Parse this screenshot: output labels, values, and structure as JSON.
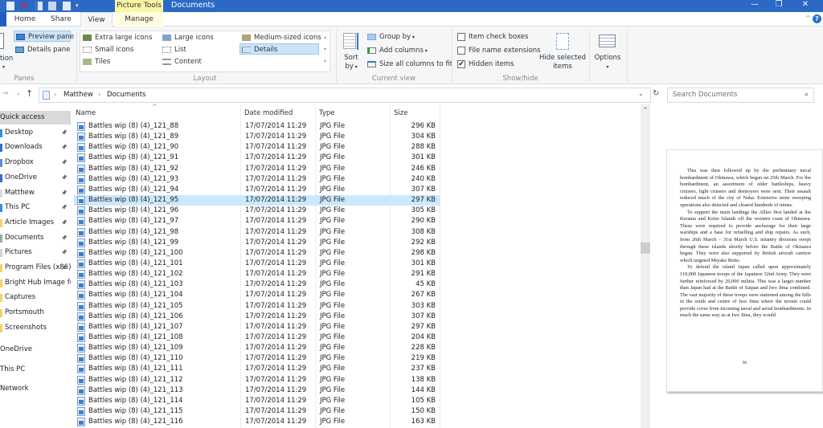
{
  "titlebar": {
    "contextual_tab": "Picture Tools",
    "window_title": "Documents",
    "quick_access_icons": [
      "new-file-icon",
      "delete-icon",
      "properties-icon",
      "recycle-icon",
      "rename-icon",
      "customize-dropdown-icon"
    ],
    "controls": {
      "minimize": "—",
      "restore": "❐",
      "close": "✕"
    }
  },
  "tabs": [
    {
      "label": "Home",
      "active": false
    },
    {
      "label": "Share",
      "active": false
    },
    {
      "label": "View",
      "active": true
    },
    {
      "label": "Manage",
      "active": false
    }
  ],
  "ribbon": {
    "panes": {
      "label": "Panes",
      "navigation_partial": "tion",
      "preview_pane": "Preview pane",
      "details_pane": "Details pane"
    },
    "layout": {
      "label": "Layout",
      "options": [
        "Extra large icons",
        "Large icons",
        "Medium-sized icons",
        "Small icons",
        "List",
        "Details",
        "Tiles",
        "Content"
      ],
      "selected": "Details"
    },
    "current_view": {
      "label": "Current view",
      "sort_by": "Sort",
      "sort_by_2": "by",
      "group_by": "Group by",
      "add_columns": "Add columns",
      "size_columns": "Size all columns to fit"
    },
    "show_hide": {
      "label": "Show/hide",
      "item_check_boxes": {
        "label": "Item check boxes",
        "checked": false
      },
      "file_name_extensions": {
        "label": "File name extensions",
        "checked": false
      },
      "hidden_items": {
        "label": "Hidden items",
        "checked": true
      },
      "hide_selected": "Hide selected",
      "hide_selected_2": "items"
    },
    "options": {
      "label": "Options"
    }
  },
  "address": {
    "path": [
      "Matthew",
      "Documents"
    ],
    "search_placeholder": "Search Documents"
  },
  "nav": {
    "items": [
      {
        "label": "Quick access",
        "pinned": false,
        "selected": true,
        "indent": false
      },
      {
        "label": "Desktop",
        "pinned": true,
        "color": "#2f8fe0"
      },
      {
        "label": "Downloads",
        "pinned": true,
        "color": "#2f6fcf"
      },
      {
        "label": "Dropbox",
        "pinned": true,
        "color": "#5a8fd0"
      },
      {
        "label": "OneDrive",
        "pinned": true,
        "color": "#2f6fcf"
      },
      {
        "label": "Matthew",
        "pinned": true,
        "color": "#d9d9d9"
      },
      {
        "label": "This PC",
        "pinned": true,
        "color": "#2f8fe0"
      },
      {
        "label": "Article Images",
        "pinned": true,
        "color": "#f2d26a"
      },
      {
        "label": "Documents",
        "pinned": true,
        "color": "#9aa6b4"
      },
      {
        "label": "Pictures",
        "pinned": true,
        "color": "#c9d3dd"
      },
      {
        "label": "Program Files (x86)",
        "pinned": true,
        "color": "#f2d26a"
      },
      {
        "label": "Bright Hub Image fo",
        "pinned": false,
        "color": "#f2d26a"
      },
      {
        "label": "Captures",
        "pinned": false,
        "color": "#f2d26a"
      },
      {
        "label": "Portsmouth",
        "pinned": false,
        "color": "#f2d26a"
      },
      {
        "label": "Screenshots",
        "pinned": false,
        "color": "#f2d26a"
      }
    ],
    "roots": [
      "OneDrive",
      "This PC",
      "Network"
    ]
  },
  "filelist": {
    "columns": [
      "Name",
      "Date modified",
      "Type",
      "Size"
    ],
    "selected_index": 7,
    "rows": [
      {
        "name": "Battles wip (8) (4)_121_88",
        "date": "17/07/2014 11:29",
        "type": "JPG File",
        "size": "296 KB"
      },
      {
        "name": "Battles wip (8) (4)_121_89",
        "date": "17/07/2014 11:29",
        "type": "JPG File",
        "size": "304 KB"
      },
      {
        "name": "Battles wip (8) (4)_121_90",
        "date": "17/07/2014 11:29",
        "type": "JPG File",
        "size": "288 KB"
      },
      {
        "name": "Battles wip (8) (4)_121_91",
        "date": "17/07/2014 11:29",
        "type": "JPG File",
        "size": "301 KB"
      },
      {
        "name": "Battles wip (8) (4)_121_92",
        "date": "17/07/2014 11:29",
        "type": "JPG File",
        "size": "246 KB"
      },
      {
        "name": "Battles wip (8) (4)_121_93",
        "date": "17/07/2014 11:29",
        "type": "JPG File",
        "size": "240 KB"
      },
      {
        "name": "Battles wip (8) (4)_121_94",
        "date": "17/07/2014 11:29",
        "type": "JPG File",
        "size": "307 KB"
      },
      {
        "name": "Battles wip (8) (4)_121_95",
        "date": "17/07/2014 11:29",
        "type": "JPG File",
        "size": "297 KB"
      },
      {
        "name": "Battles wip (8) (4)_121_96",
        "date": "17/07/2014 11:29",
        "type": "JPG File",
        "size": "305 KB"
      },
      {
        "name": "Battles wip (8) (4)_121_97",
        "date": "17/07/2014 11:29",
        "type": "JPG File",
        "size": "290 KB"
      },
      {
        "name": "Battles wip (8) (4)_121_98",
        "date": "17/07/2014 11:29",
        "type": "JPG File",
        "size": "308 KB"
      },
      {
        "name": "Battles wip (8) (4)_121_99",
        "date": "17/07/2014 11:29",
        "type": "JPG File",
        "size": "292 KB"
      },
      {
        "name": "Battles wip (8) (4)_121_100",
        "date": "17/07/2014 11:29",
        "type": "JPG File",
        "size": "298 KB"
      },
      {
        "name": "Battles wip (8) (4)_121_101",
        "date": "17/07/2014 11:29",
        "type": "JPG File",
        "size": "301 KB"
      },
      {
        "name": "Battles wip (8) (4)_121_102",
        "date": "17/07/2014 11:29",
        "type": "JPG File",
        "size": "291 KB"
      },
      {
        "name": "Battles wip (8) (4)_121_103",
        "date": "17/07/2014 11:29",
        "type": "JPG File",
        "size": "45 KB"
      },
      {
        "name": "Battles wip (8) (4)_121_104",
        "date": "17/07/2014 11:29",
        "type": "JPG File",
        "size": "267 KB"
      },
      {
        "name": "Battles wip (8) (4)_121_105",
        "date": "17/07/2014 11:29",
        "type": "JPG File",
        "size": "303 KB"
      },
      {
        "name": "Battles wip (8) (4)_121_106",
        "date": "17/07/2014 11:29",
        "type": "JPG File",
        "size": "307 KB"
      },
      {
        "name": "Battles wip (8) (4)_121_107",
        "date": "17/07/2014 11:29",
        "type": "JPG File",
        "size": "297 KB"
      },
      {
        "name": "Battles wip (8) (4)_121_108",
        "date": "17/07/2014 11:29",
        "type": "JPG File",
        "size": "204 KB"
      },
      {
        "name": "Battles wip (8) (4)_121_109",
        "date": "17/07/2014 11:29",
        "type": "JPG File",
        "size": "228 KB"
      },
      {
        "name": "Battles wip (8) (4)_121_110",
        "date": "17/07/2014 11:29",
        "type": "JPG File",
        "size": "219 KB"
      },
      {
        "name": "Battles wip (8) (4)_121_111",
        "date": "17/07/2014 11:29",
        "type": "JPG File",
        "size": "237 KB"
      },
      {
        "name": "Battles wip (8) (4)_121_112",
        "date": "17/07/2014 11:29",
        "type": "JPG File",
        "size": "138 KB"
      },
      {
        "name": "Battles wip (8) (4)_121_113",
        "date": "17/07/2014 11:29",
        "type": "JPG File",
        "size": "144 KB"
      },
      {
        "name": "Battles wip (8) (4)_121_114",
        "date": "17/07/2014 11:29",
        "type": "JPG File",
        "size": "105 KB"
      },
      {
        "name": "Battles wip (8) (4)_121_115",
        "date": "17/07/2014 11:29",
        "type": "JPG File",
        "size": "150 KB"
      },
      {
        "name": "Battles wip (8) (4)_121_116",
        "date": "17/07/2014 11:29",
        "type": "JPG File",
        "size": "163 KB"
      }
    ]
  },
  "preview": {
    "paragraphs": [
      "This was then followed up by the preliminary naval bombardment of Okinawa, which began on 25th March. For the bombardment, an assortment of older battleships, heavy cruisers, light cruisers and destroyers were sent. Their assault reduced much of the city of Naha. Extensive mine sweeping operations also detected and cleared hundreds of mines.",
      "To support the main landings the Allies first landed at the Kerama and Keise Islands off the western coast of Okinawa. These were required to provide anchorage for their large warships and a base for refuelling and ship repairs. As such, from 26th March – 31st March U.S. infantry divisions swept through these islands shortly before the Battle of Okinawa began. They were also supported by British aircraft carriers which targeted Miyako Retto.",
      "To defend the island Japan called upon approximately 110,000 Japanese troops of the Japanese 32nd Army. They were further reinforced by 20,000 militia. This was a larger number than Japan had at the Battle of Saipan and Iwo Jima combined. The vast majority of these troops were stationed among the hills in the south and centre of Iwo Jima where the terrain could provide cover from incoming naval and aerial bombardments. In much the same way as at Iwo Jima, they would"
    ],
    "page_number": "96"
  }
}
